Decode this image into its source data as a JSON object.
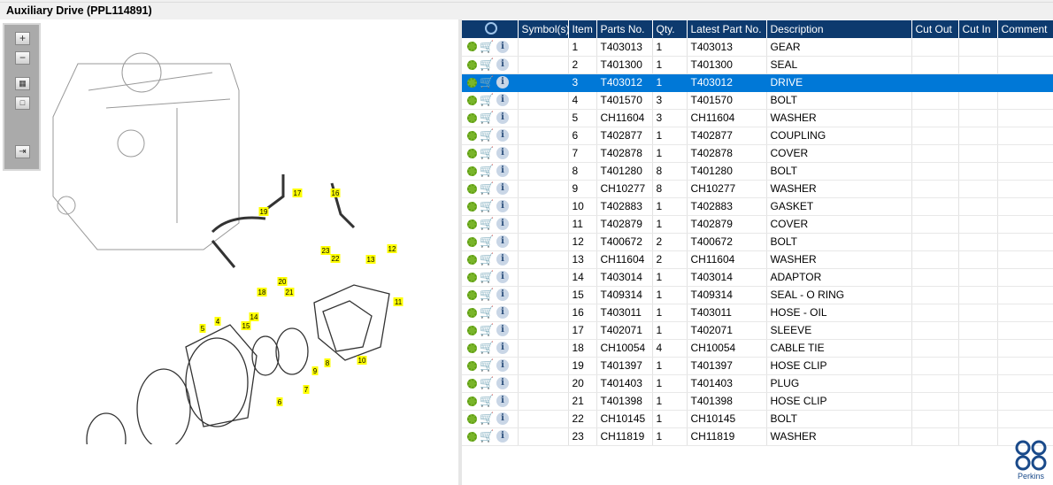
{
  "title": "Auxiliary Drive (PPL114891)",
  "toolbar": {
    "zoom_in": "+",
    "zoom_out": "−"
  },
  "table": {
    "headers": [
      "Symbol(s)",
      "Item",
      "Parts No.",
      "Qty.",
      "Latest Part No.",
      "Description",
      "Cut Out",
      "Cut In",
      "Comment"
    ],
    "selected_item": "3",
    "rows": [
      {
        "item": "1",
        "part": "T403013",
        "qty": "1",
        "latest": "T403013",
        "desc": "GEAR"
      },
      {
        "item": "2",
        "part": "T401300",
        "qty": "1",
        "latest": "T401300",
        "desc": "SEAL"
      },
      {
        "item": "3",
        "part": "T403012",
        "qty": "1",
        "latest": "T403012",
        "desc": "DRIVE"
      },
      {
        "item": "4",
        "part": "T401570",
        "qty": "3",
        "latest": "T401570",
        "desc": "BOLT"
      },
      {
        "item": "5",
        "part": "CH11604",
        "qty": "3",
        "latest": "CH11604",
        "desc": "WASHER"
      },
      {
        "item": "6",
        "part": "T402877",
        "qty": "1",
        "latest": "T402877",
        "desc": "COUPLING"
      },
      {
        "item": "7",
        "part": "T402878",
        "qty": "1",
        "latest": "T402878",
        "desc": "COVER"
      },
      {
        "item": "8",
        "part": "T401280",
        "qty": "8",
        "latest": "T401280",
        "desc": "BOLT"
      },
      {
        "item": "9",
        "part": "CH10277",
        "qty": "8",
        "latest": "CH10277",
        "desc": "WASHER"
      },
      {
        "item": "10",
        "part": "T402883",
        "qty": "1",
        "latest": "T402883",
        "desc": "GASKET"
      },
      {
        "item": "11",
        "part": "T402879",
        "qty": "1",
        "latest": "T402879",
        "desc": "COVER"
      },
      {
        "item": "12",
        "part": "T400672",
        "qty": "2",
        "latest": "T400672",
        "desc": "BOLT"
      },
      {
        "item": "13",
        "part": "CH11604",
        "qty": "2",
        "latest": "CH11604",
        "desc": "WASHER"
      },
      {
        "item": "14",
        "part": "T403014",
        "qty": "1",
        "latest": "T403014",
        "desc": "ADAPTOR"
      },
      {
        "item": "15",
        "part": "T409314",
        "qty": "1",
        "latest": "T409314",
        "desc": "SEAL - O RING"
      },
      {
        "item": "16",
        "part": "T403011",
        "qty": "1",
        "latest": "T403011",
        "desc": "HOSE - OIL"
      },
      {
        "item": "17",
        "part": "T402071",
        "qty": "1",
        "latest": "T402071",
        "desc": "SLEEVE"
      },
      {
        "item": "18",
        "part": "CH10054",
        "qty": "4",
        "latest": "CH10054",
        "desc": "CABLE TIE"
      },
      {
        "item": "19",
        "part": "T401397",
        "qty": "1",
        "latest": "T401397",
        "desc": "HOSE CLIP"
      },
      {
        "item": "20",
        "part": "T401403",
        "qty": "1",
        "latest": "T401403",
        "desc": "PLUG"
      },
      {
        "item": "21",
        "part": "T401398",
        "qty": "1",
        "latest": "T401398",
        "desc": "HOSE CLIP"
      },
      {
        "item": "22",
        "part": "CH10145",
        "qty": "1",
        "latest": "CH10145",
        "desc": "BOLT"
      },
      {
        "item": "23",
        "part": "CH11819",
        "qty": "1",
        "latest": "CH11819",
        "desc": "WASHER"
      }
    ]
  },
  "logo": "Perkins",
  "colors": {
    "header": "#0d3a6e",
    "selected": "#0078d7",
    "callout": "#ffff00",
    "callout_selected": "#ff6b6b"
  }
}
